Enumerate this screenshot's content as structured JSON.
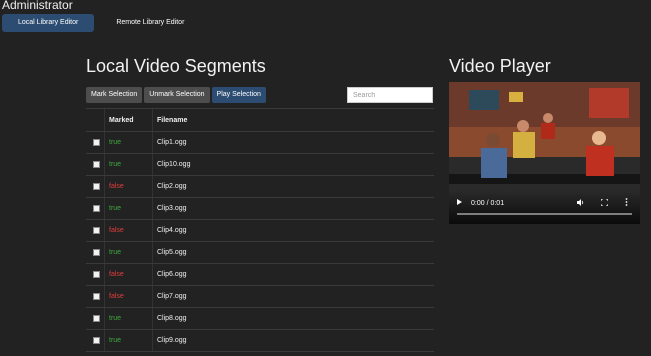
{
  "app": {
    "title": "Administrator"
  },
  "nav": {
    "tabs": [
      {
        "label": "Local Library Editor",
        "active": true
      },
      {
        "label": "Remote Library Editor",
        "active": false
      }
    ]
  },
  "segments": {
    "title": "Local Video Segments",
    "toolbar": {
      "mark_label": "Mark Selection",
      "unmark_label": "Unmark Selection",
      "play_label": "Play Selection"
    },
    "search": {
      "placeholder": "Search",
      "value": ""
    },
    "table": {
      "headers": {
        "marked": "Marked",
        "filename": "Filename"
      },
      "rows": [
        {
          "marked": "true",
          "filename": "Clip1.ogg"
        },
        {
          "marked": "true",
          "filename": "Clip10.ogg"
        },
        {
          "marked": "false",
          "filename": "Clip2.ogg"
        },
        {
          "marked": "true",
          "filename": "Clip3.ogg"
        },
        {
          "marked": "false",
          "filename": "Clip4.ogg"
        },
        {
          "marked": "true",
          "filename": "Clip5.ogg"
        },
        {
          "marked": "false",
          "filename": "Clip6.ogg"
        },
        {
          "marked": "false",
          "filename": "Clip7.ogg"
        },
        {
          "marked": "true",
          "filename": "Clip8.ogg"
        },
        {
          "marked": "true",
          "filename": "Clip9.ogg"
        }
      ]
    }
  },
  "player": {
    "title": "Video Player",
    "time": "0:00 / 0:01",
    "progress": 0,
    "icons": [
      "play-icon",
      "volume-icon",
      "fullscreen-icon",
      "more-options-icon"
    ]
  },
  "colors": {
    "accent": "#2c4c72",
    "true_color": "#3ea83e",
    "false_color": "#e03c3c",
    "background": "#222222"
  }
}
